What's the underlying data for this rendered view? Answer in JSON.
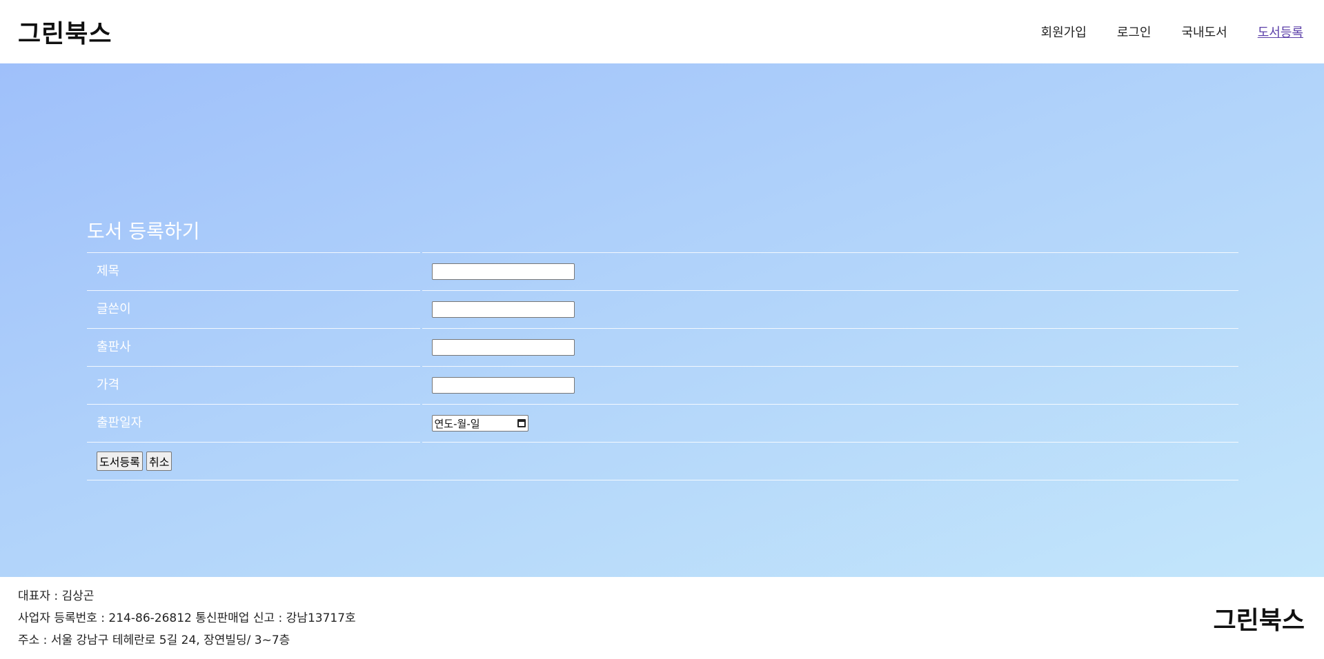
{
  "header": {
    "logo": "그린북스",
    "nav": [
      {
        "label": "회원가입"
      },
      {
        "label": "로그인"
      },
      {
        "label": "국내도서"
      },
      {
        "label": "도서등록"
      }
    ]
  },
  "form": {
    "title": "도서 등록하기",
    "fields": [
      {
        "label": "제목",
        "value": ""
      },
      {
        "label": "글쓴이",
        "value": ""
      },
      {
        "label": "출판사",
        "value": ""
      },
      {
        "label": "가격",
        "value": ""
      },
      {
        "label": "출판일자",
        "date_placeholder": "연도-월-일"
      }
    ],
    "submit_label": "도서등록",
    "cancel_label": "취소"
  },
  "footer": {
    "line1": "대표자 : 김상곤",
    "line2": "사업자 등록번호 : 214-86-26812 통신판매업 신고 : 강남13717호",
    "line3": "주소 : 서울 강남구 테헤란로 5길 24, 장연빌딩/ 3~7층",
    "logo": "그린북스"
  }
}
